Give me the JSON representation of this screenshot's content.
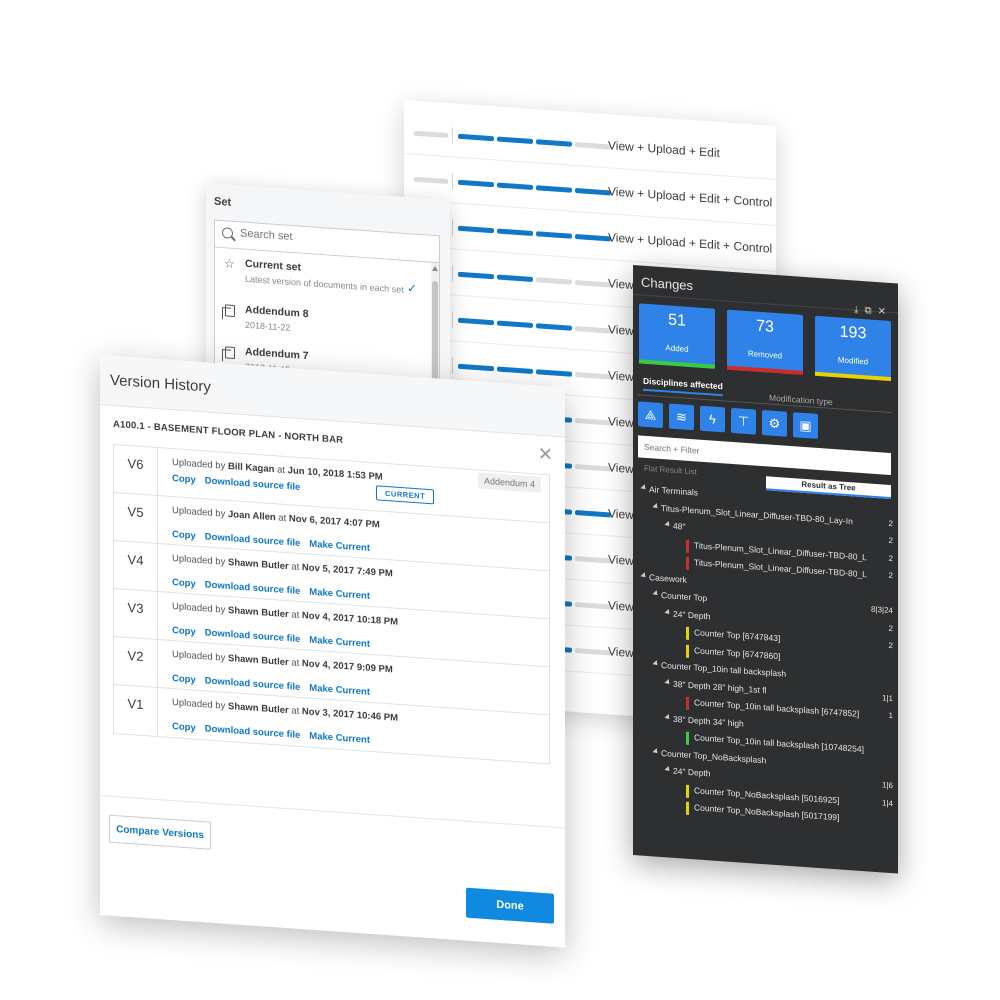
{
  "permissions": {
    "rows": [
      {
        "label": "View + Upload + Edit",
        "level": 3
      },
      {
        "label": "View + Upload + Edit + Control",
        "level": 4
      },
      {
        "label": "View + Upload + Edit + Control",
        "level": 4
      },
      {
        "label": "View",
        "level": 2
      },
      {
        "label": "View",
        "level": 3
      },
      {
        "label": "View",
        "level": 3
      },
      {
        "label": "View",
        "level": 3
      },
      {
        "label": "View",
        "level": 3
      },
      {
        "label": "View",
        "level": 4
      },
      {
        "label": "View",
        "level": 3
      },
      {
        "label": "View",
        "level": 3
      },
      {
        "label": "View",
        "level": 3
      }
    ]
  },
  "set_panel": {
    "title": "Set",
    "search_placeholder": "Search set",
    "items": [
      {
        "name": "Current set",
        "sub": "Latest version of documents in each set",
        "icon": "star-icon"
      },
      {
        "name": "Addendum 8",
        "sub": "2018-11-22",
        "icon": "document-stack-icon"
      },
      {
        "name": "Addendum 7",
        "sub": "2018-11-15",
        "icon": "document-stack-icon"
      }
    ]
  },
  "version_history": {
    "title": "Version History",
    "document": "A100.1 - BASEMENT FLOOR PLAN - NORTH BAR",
    "uploaded_prefix": "Uploaded by",
    "at_word": "at",
    "copy_label": "Copy",
    "download_label": "Download source file",
    "make_current_label": "Make Current",
    "current_badge": "CURRENT",
    "versions": [
      {
        "v": "V6",
        "user": "Bill Kagan",
        "date": "Jun 10, 2018 1:53 PM",
        "current": true,
        "addendum": "Addendum 4"
      },
      {
        "v": "V5",
        "user": "Joan Allen",
        "date": "Nov 6, 2017 4:07 PM"
      },
      {
        "v": "V4",
        "user": "Shawn Butler",
        "date": "Nov 5, 2017 7:49 PM"
      },
      {
        "v": "V3",
        "user": "Shawn Butler",
        "date": "Nov 4, 2017 10:18 PM"
      },
      {
        "v": "V2",
        "user": "Shawn Butler",
        "date": "Nov 4, 2017 9:09 PM"
      },
      {
        "v": "V1",
        "user": "Shawn Butler",
        "date": "Nov 3, 2017 10:46 PM"
      }
    ],
    "compare_label": "Compare Versions",
    "done_label": "Done"
  },
  "changes": {
    "title": "Changes",
    "cards": [
      {
        "value": "51",
        "label": "Added",
        "strip": "#3bcc3b"
      },
      {
        "value": "73",
        "label": "Removed",
        "strip": "#d02b2b"
      },
      {
        "value": "193",
        "label": "Modified",
        "strip": "#e8d200"
      }
    ],
    "tab_active": "Disciplines affected",
    "tab_inactive": "Modification type",
    "disciplines": [
      "drafting-compass-icon",
      "layers-icon",
      "lightning-icon",
      "faucet-icon",
      "gear-tools-icon",
      "box-icon"
    ],
    "search_placeholder": "Search + Filter",
    "view_flat": "Flat Result List",
    "view_tree": "Result as Tree",
    "tree": [
      {
        "text": "Air Terminals",
        "indent": 0,
        "caret": true
      },
      {
        "text": "Titus-Plenum_Slot_Linear_Diffuser-TBD-80_Lay-In",
        "indent": 1,
        "caret": true,
        "count": "2"
      },
      {
        "text": "48\"",
        "indent": 2,
        "caret": true,
        "count": "2"
      },
      {
        "text": "Titus-Plenum_Slot_Linear_Diffuser-TBD-80_L",
        "indent": 3,
        "marker": "red",
        "count": "2"
      },
      {
        "text": "Titus-Plenum_Slot_Linear_Diffuser-TBD-80_L",
        "indent": 3,
        "marker": "red",
        "count": "2"
      },
      {
        "text": "Casework",
        "indent": 0,
        "caret": true
      },
      {
        "text": "Counter Top",
        "indent": 1,
        "caret": true,
        "count": "8|3|24"
      },
      {
        "text": "24\" Depth",
        "indent": 2,
        "caret": true,
        "count": "2"
      },
      {
        "text": "Counter Top [6747843]",
        "indent": 3,
        "marker": "yellow",
        "count": "2"
      },
      {
        "text": "Counter Top [6747860]",
        "indent": 3,
        "marker": "yellow"
      },
      {
        "text": "Counter Top_10in tall backsplash",
        "indent": 1,
        "caret": true
      },
      {
        "text": "38\" Depth 28\" high_1st fl",
        "indent": 2,
        "caret": true,
        "count": "1|1"
      },
      {
        "text": "Counter Top_10in tall backsplash [6747852]",
        "indent": 3,
        "marker": "red",
        "count": "1"
      },
      {
        "text": "38\" Depth 34\" high",
        "indent": 2,
        "caret": true
      },
      {
        "text": "Counter Top_10in tall backsplash [10748254]",
        "indent": 3,
        "marker": "green"
      },
      {
        "text": "Counter Top_NoBacksplash",
        "indent": 1,
        "caret": true
      },
      {
        "text": "24\" Depth",
        "indent": 2,
        "caret": true,
        "count": "1|6"
      },
      {
        "text": "Counter Top_NoBacksplash [5016925]",
        "indent": 3,
        "marker": "yellow",
        "count": "1|4"
      },
      {
        "text": "Counter Top_NoBacksplash [5017199]",
        "indent": 3,
        "marker": "yellow"
      }
    ]
  }
}
